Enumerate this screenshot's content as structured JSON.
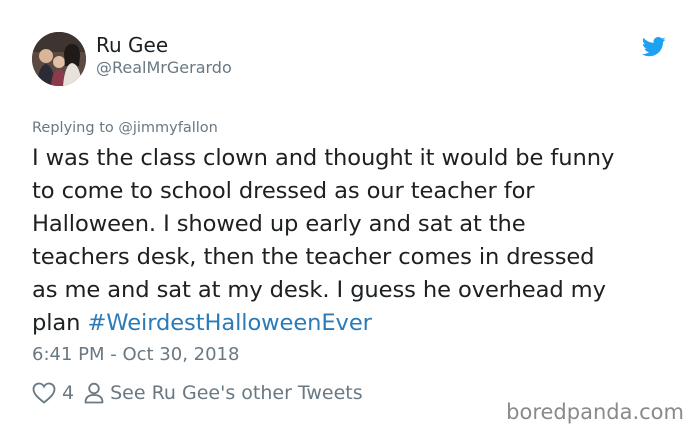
{
  "author": {
    "display_name": "Ru Gee",
    "handle": "@RealMrGerardo"
  },
  "reply": {
    "prefix": "Replying to",
    "mention": "@jimmyfallon"
  },
  "tweet": {
    "lines": [
      "I was the class clown and thought it would be funny",
      "to come to school dressed as our teacher for",
      "Halloween. I showed up early and sat at the",
      "teachers desk, then the teacher comes in dressed",
      "as me and sat at my desk. I guess he overhead my",
      "plan "
    ],
    "hashtag": "#WeirdestHalloweenEver",
    "timestamp": "6:41 PM - Oct 30, 2018"
  },
  "actions": {
    "like_count": "4",
    "profile_link": "See Ru Gee's other Tweets"
  },
  "watermark": "boredpanda.com",
  "colors": {
    "text": "#1c2022",
    "muted": "#697882",
    "link": "#2b7bb9",
    "twitter_blue": "#1da1f2"
  },
  "icons": [
    "avatar",
    "twitter-bird-icon",
    "heart-icon",
    "person-icon"
  ]
}
